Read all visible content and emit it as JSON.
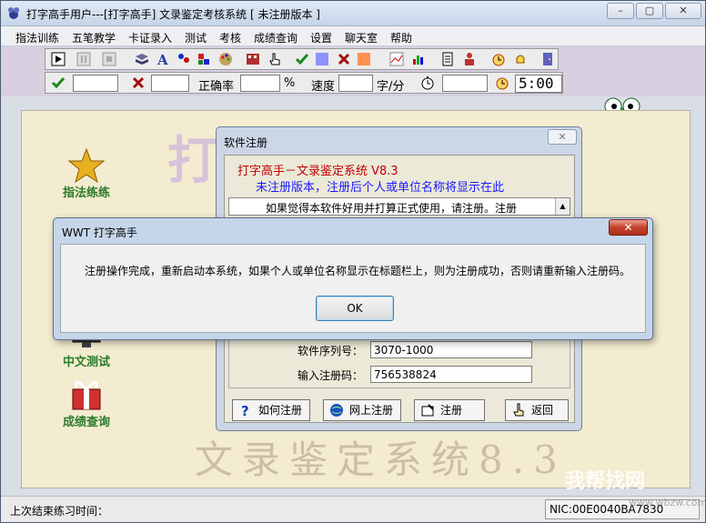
{
  "window": {
    "title": "打字高手用户---[打字高手]    文录鉴定考核系统 [ 未注册版本 ]",
    "min_glyph": "–",
    "max_glyph": "▢",
    "close_glyph": "✕"
  },
  "menu": [
    "指法训练",
    "五笔教学",
    "卡证录入",
    "测试",
    "考核",
    "成绩查询",
    "设置",
    "聊天室",
    "帮助"
  ],
  "toolbar": {
    "correct_label": "正确率",
    "percent_label": "%",
    "speed_label": "速度",
    "speed_unit": "字/分",
    "timer_value": "5:00"
  },
  "background": {
    "big_title": "打字高手",
    "bottom_title": "文录鉴定系统8.3"
  },
  "side_buttons": [
    {
      "label": "指法练练"
    },
    {
      "label": "中文测试"
    },
    {
      "label": "成绩查询"
    }
  ],
  "status": {
    "last_time_label": "上次结束练习时间：",
    "nic": "NIC:00E0040BA7830"
  },
  "watermark": {
    "text": "我帮找网",
    "url": "www.wbzw.com"
  },
  "reg_dialog": {
    "title": "软件注册",
    "line1": "打字高手－文录鉴定系统 V8.3",
    "line2": "未注册版本，注册后个人或单位名称将显示在此",
    "notice": "如果觉得本软件好用并打算正式使用，请注册。注册",
    "serial_label": "软件序列号：",
    "serial_value": "3070-1000",
    "code_label": "输入注册码：",
    "code_value": "756538824",
    "buttons": {
      "how": "如何注册",
      "online": "网上注册",
      "register": "注册",
      "back": "返回"
    }
  },
  "msgbox": {
    "title": "WWT 打字高手",
    "close_glyph": "✕",
    "text": "注册操作完成，重新启动本系统，如果个人或单位名称显示在标题栏上，则为注册成功，否则请重新输入注册码。",
    "ok": "OK"
  }
}
